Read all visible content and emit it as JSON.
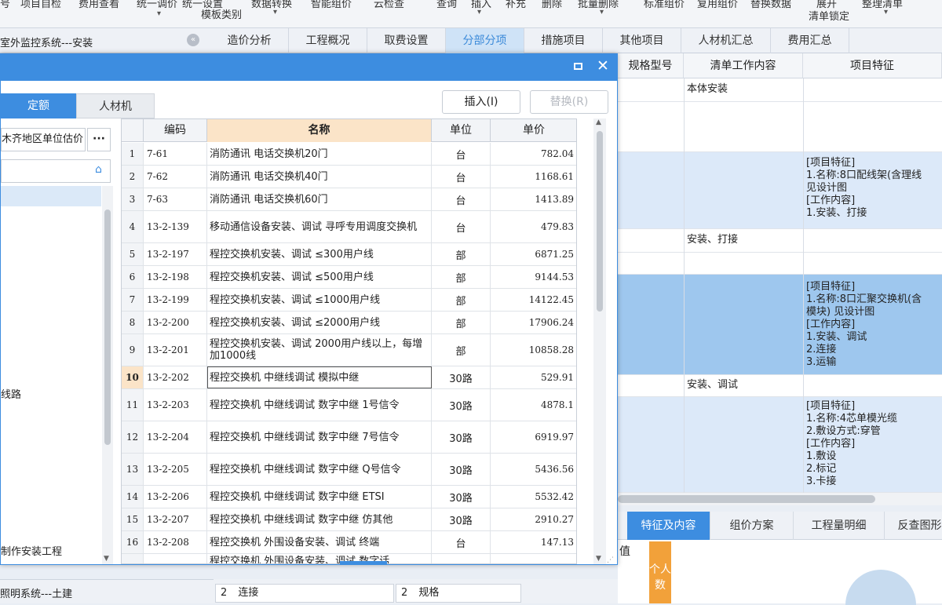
{
  "ribbon": {
    "items": [
      {
        "label": "号",
        "caret": false
      },
      {
        "label": "项目自检",
        "caret": false
      },
      {
        "label": "费用查看",
        "caret": false
      },
      {
        "label": "统一调价",
        "caret": true
      },
      {
        "label": "统一设置",
        "caret": false
      },
      {
        "label": "数据转换",
        "caret": false
      },
      {
        "label": "智能组价",
        "caret": false
      },
      {
        "label": "云检查",
        "caret": false
      },
      {
        "label": "查询",
        "caret": false
      },
      {
        "label": "插入",
        "caret": true
      },
      {
        "label": "补充",
        "caret": false
      },
      {
        "label": "删除",
        "caret": false
      },
      {
        "label": "批量删除",
        "caret": true
      },
      {
        "label": "标准组价",
        "caret": false
      },
      {
        "label": "复用组价",
        "caret": false
      },
      {
        "label": "替换数据",
        "caret": false
      },
      {
        "label": "展开",
        "caret": false
      },
      {
        "label": "整理清单",
        "caret": false
      }
    ],
    "template_label": "模板类别",
    "lock_label": "清单锁定"
  },
  "tabbar": {
    "project_title": "室外监控系统---安装",
    "tabs": [
      "造价分析",
      "工程概况",
      "取费设置",
      "分部分项",
      "措施项目",
      "其他项目",
      "人材机汇总",
      "费用汇总"
    ],
    "active_tab": "分部分项"
  },
  "bg_grid": {
    "headers": [
      "规格型号",
      "清单工作内容",
      "项目特征"
    ],
    "rows": [
      {
        "content": "本体安装",
        "feature": ""
      },
      {
        "content": "",
        "feature": ""
      },
      {
        "content": "",
        "feature": "[项目特征]\n1.名称:8口配线架(含理线\n见设计图\n[工作内容]\n1.安装、打接"
      },
      {
        "content": "安装、打接",
        "feature": ""
      },
      {
        "content": "",
        "feature": ""
      },
      {
        "content": "",
        "feature": "[项目特征]\n1.名称:8口汇聚交换机(含\n模块) 见设计图\n[工作内容]\n1.安装、调试\n2.连接\n3.运输"
      },
      {
        "content": "安装、调试",
        "feature": ""
      },
      {
        "content": "",
        "feature": "[项目特征]\n1.名称:4芯单模光缆\n2.敷设方式:穿管\n[工作内容]\n1.敷设\n2.标记\n3.卡接"
      }
    ]
  },
  "bottom": {
    "tabs": [
      "特征及内容",
      "组价方案",
      "工程量明细",
      "反查图形"
    ],
    "active_tab": "特征及内容",
    "value_label": "值",
    "orange_tab_label": "个人数",
    "left_status": "照明系统---土建",
    "grid_cells": [
      {
        "num": "2",
        "text": "连接"
      },
      {
        "num": "2",
        "text": "规格"
      }
    ]
  },
  "dialog": {
    "tabs": {
      "quota": "定额",
      "material": "人材机"
    },
    "buttons": {
      "insert": "插入(I)",
      "replace": "替换(R)"
    },
    "region_select": "木齐地区单位估价",
    "region_more": "···",
    "tree_items": [
      "线路",
      "制作安装工程"
    ],
    "table": {
      "headers": {
        "index": "",
        "code": "编码",
        "name": "名称",
        "unit": "单位",
        "price": "单价"
      },
      "rows": [
        {
          "idx": "1",
          "code": "7-61",
          "name": "消防通讯 电话交换机20门",
          "unit": "台",
          "price": "782.04"
        },
        {
          "idx": "2",
          "code": "7-62",
          "name": "消防通讯 电话交换机40门",
          "unit": "台",
          "price": "1168.61"
        },
        {
          "idx": "3",
          "code": "7-63",
          "name": "消防通讯 电话交换机60门",
          "unit": "台",
          "price": "1413.89"
        },
        {
          "idx": "4",
          "code": "13-2-139",
          "name": "移动通信设备安装、调试 寻呼专用调度交换机",
          "unit": "台",
          "price": "479.83"
        },
        {
          "idx": "5",
          "code": "13-2-197",
          "name": "程控交换机安装、调试 ≤300用户线",
          "unit": "部",
          "price": "6871.25"
        },
        {
          "idx": "6",
          "code": "13-2-198",
          "name": "程控交换机安装、调试 ≤500用户线",
          "unit": "部",
          "price": "9144.53"
        },
        {
          "idx": "7",
          "code": "13-2-199",
          "name": "程控交换机安装、调试 ≤1000用户线",
          "unit": "部",
          "price": "14122.45"
        },
        {
          "idx": "8",
          "code": "13-2-200",
          "name": "程控交换机安装、调试 ≤2000用户线",
          "unit": "部",
          "price": "17906.24"
        },
        {
          "idx": "9",
          "code": "13-2-201",
          "name": "程控交换机安装、调试 2000用户线以上，每增加1000线",
          "unit": "部",
          "price": "10858.28"
        },
        {
          "idx": "10",
          "code": "13-2-202",
          "name": "程控交换机 中继线调试 模拟中继",
          "unit": "30路",
          "price": "529.91"
        },
        {
          "idx": "11",
          "code": "13-2-203",
          "name": "程控交换机 中继线调试 数字中继 1号信令",
          "unit": "30路",
          "price": "4878.1"
        },
        {
          "idx": "12",
          "code": "13-2-204",
          "name": "程控交换机 中继线调试 数字中继 7号信令",
          "unit": "30路",
          "price": "6919.97"
        },
        {
          "idx": "13",
          "code": "13-2-205",
          "name": "程控交换机 中继线调试 数字中继 Q号信令",
          "unit": "30路",
          "price": "5436.56"
        },
        {
          "idx": "14",
          "code": "13-2-206",
          "name": "程控交换机 中继线调试 数字中继 ETSI",
          "unit": "30路",
          "price": "5532.42"
        },
        {
          "idx": "15",
          "code": "13-2-207",
          "name": "程控交换机 中继线调试 数字中继 仿其他",
          "unit": "30路",
          "price": "2910.27"
        },
        {
          "idx": "16",
          "code": "13-2-208",
          "name": "程控交换机 外围设备安装、调试 终端",
          "unit": "台",
          "price": "147.13"
        },
        {
          "idx": "",
          "code": "",
          "name": "程控交换机 外围设备安装、调试 数字话",
          "unit": "",
          "price": ""
        }
      ]
    }
  },
  "colors": {
    "accent": "#3d8de0",
    "header_highlight": "#fbe4c8",
    "orange": "#f2a13a",
    "row_blue": "#dce9f9",
    "row_selected": "#9ec7ee"
  }
}
